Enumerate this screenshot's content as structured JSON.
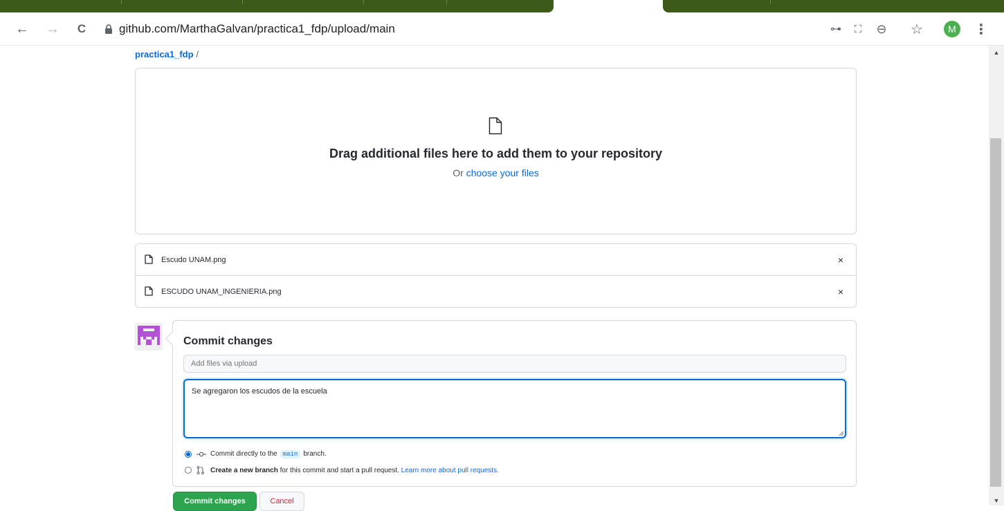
{
  "browser": {
    "url": "github.com/MarthaGalvan/practica1_fdp/upload/main",
    "profile_initial": "M",
    "icons": [
      "back-icon",
      "forward-icon",
      "reload-icon",
      "lock-icon",
      "key-icon",
      "translate-icon",
      "zoom-out-icon",
      "bookmark-star-icon",
      "more-vert-icon"
    ],
    "nav": {
      "back": "←",
      "forward": "→",
      "reload": "C"
    },
    "toolbar_glyphs": {
      "key": "⊶",
      "translate": "⛶",
      "zoom": "⊖",
      "star": "☆",
      "more": "⋮"
    }
  },
  "scrollbar": {
    "up": "▲",
    "down": "▼"
  },
  "breadcrumb": {
    "repo": "practica1_fdp",
    "separator": "/"
  },
  "dropzone": {
    "title": "Drag additional files here to add them to your repository",
    "prefix": "Or",
    "link": "choose your files"
  },
  "files": [
    {
      "name": "Escudo UNAM.png",
      "remove": "×"
    },
    {
      "name": "ESCUDO UNAM_INGENIERIA.png",
      "remove": "×"
    }
  ],
  "commit": {
    "title": "Commit changes",
    "summary_placeholder": "Add files via upload",
    "description": "Se agregaron los escudos de la escuela",
    "option_direct": {
      "prefix": "Commit directly to the",
      "branch": "main",
      "suffix": "branch.",
      "selected": true
    },
    "option_new": {
      "bold": "Create a new branch",
      "text": "for this commit and start a pull request.",
      "link": "Learn more about pull requests.",
      "selected": false
    },
    "submit_label": "Commit changes",
    "cancel_label": "Cancel"
  },
  "colors": {
    "accent": "#0969da",
    "primary_button": "#2da44e",
    "danger": "#cf222e",
    "tab_strip": "#3e5a1a"
  }
}
